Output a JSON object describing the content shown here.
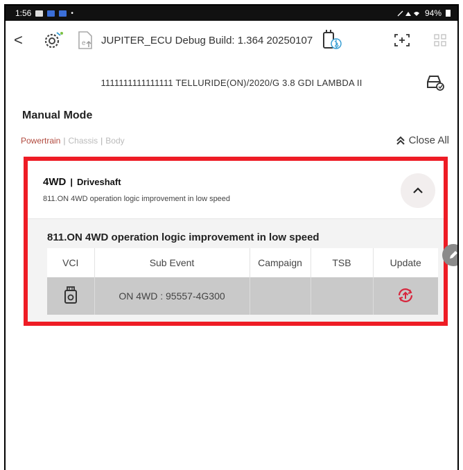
{
  "status_bar": {
    "time": "1:56",
    "battery": "94%"
  },
  "header": {
    "back_label": "<",
    "title": "JUPITER_ECU Debug Build: 1.364 20250107"
  },
  "vehicle": {
    "info": "1111111111111111  TELLURIDE(ON)/2020/G 3.8 GDI LAMBDA II"
  },
  "mode_title": "Manual Mode",
  "categories": {
    "items": [
      "Powertrain",
      "Chassis",
      "Body"
    ],
    "separator": "|"
  },
  "close_all_label": "Close All",
  "card": {
    "name": "4WD",
    "separator": "|",
    "system": "Driveshaft",
    "subtitle": "811.ON 4WD operation logic improvement in low speed",
    "event_title": "811.ON 4WD operation logic improvement in low speed",
    "columns": [
      "VCI",
      "Sub Event",
      "Campaign",
      "TSB",
      "Update"
    ],
    "row": {
      "sub_event": "ON 4WD : 95557-4G300",
      "campaign": "",
      "tsb": ""
    }
  },
  "colors": {
    "highlight": "#ee1c25",
    "accent_red": "#b14a3e",
    "update_icon": "#d7263d"
  },
  "icons": [
    "back-icon",
    "settings-icon",
    "export-icon",
    "bluetooth-vci-icon",
    "screenshot-icon",
    "grid-icon",
    "vehicle-status-icon",
    "chevron-up-icon",
    "vci-device-icon",
    "update-icon",
    "edit-icon"
  ]
}
